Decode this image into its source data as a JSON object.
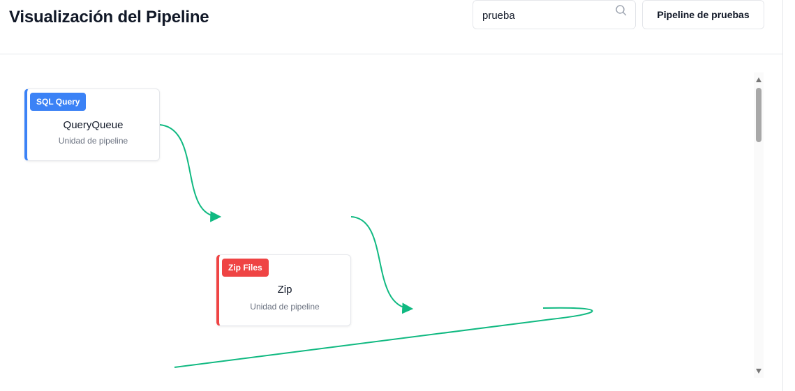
{
  "header": {
    "title": "Visualización del Pipeline",
    "search_value": "prueba",
    "pipeline_button_label": "Pipeline de pruebas"
  },
  "icons": {
    "search": "search-icon"
  },
  "nodes": [
    {
      "badge": "SQL Query",
      "badge_color": "#3b82f6",
      "name": "QueryQueue",
      "subtitle": "Unidad de pipeline"
    },
    {
      "badge": "Zip Files",
      "badge_color": "#ef4444",
      "name": "Zip",
      "subtitle": "Unidad de pipeline"
    }
  ],
  "colors": {
    "edge": "#10b981",
    "border": "#e5e7eb",
    "text_primary": "#111827",
    "text_secondary": "#6b7280"
  }
}
